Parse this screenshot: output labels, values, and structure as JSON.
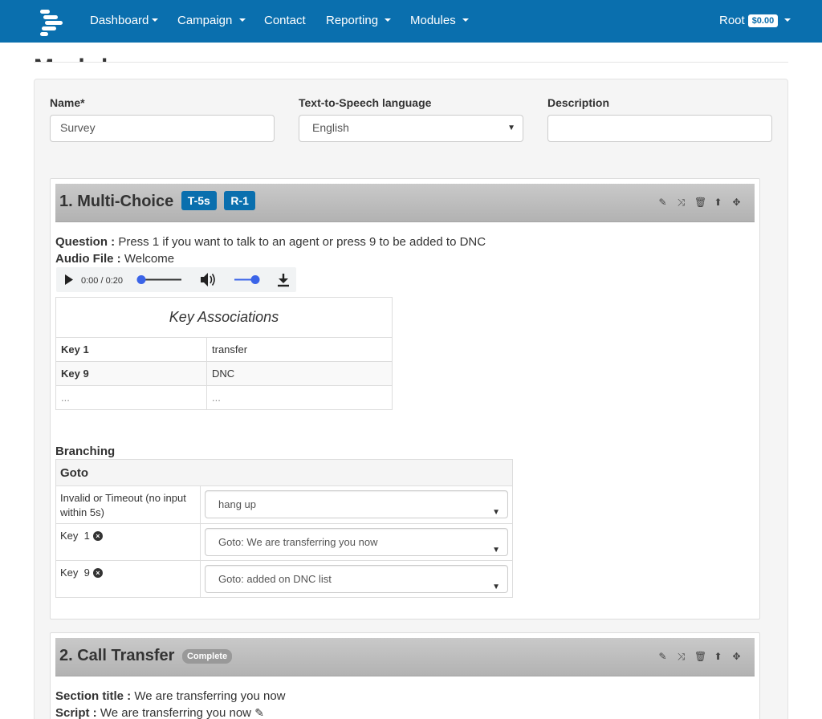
{
  "navbar": {
    "items": [
      "Dashboard",
      "Campaign",
      "Contact",
      "Reporting",
      "Modules"
    ],
    "user": "Root",
    "balance": "$0.00"
  },
  "page_title": "Modul",
  "form": {
    "name_label": "Name*",
    "name_value": "Survey",
    "tts_label": "Text-to-Speech language",
    "tts_value": "English",
    "desc_label": "Description",
    "desc_value": ""
  },
  "section1": {
    "title": "1. Multi-Choice",
    "tag_timeout": "T-5s",
    "tag_retry": "R-1",
    "question_label": "Question :",
    "question_value": "Press 1 if you want to talk to an agent or press 9 to be added to DNC",
    "audio_label": "Audio File :",
    "audio_value": "Welcome",
    "audio_time": "0:00 / 0:20",
    "audio_progress": 0,
    "audio_volume": 1,
    "key_table": {
      "title": "Key Associations",
      "rows": [
        {
          "key": "Key 1",
          "value": "transfer"
        },
        {
          "key": "Key 9",
          "value": "DNC"
        },
        {
          "key": "...",
          "value": "..."
        }
      ]
    },
    "branching": {
      "title": "Branching",
      "header": "Goto",
      "rows": [
        {
          "label": "Invalid or Timeout (no input within 5s)",
          "removable": false,
          "value": "hang up"
        },
        {
          "label": "Key  1",
          "removable": true,
          "value": "Goto: We are transferring you now"
        },
        {
          "label": "Key  9",
          "removable": true,
          "value": "Goto: added on DNC list"
        }
      ]
    }
  },
  "section2": {
    "title": "2. Call Transfer",
    "tag_status": "Complete",
    "section_title_label": "Section title :",
    "section_title_value": "We are transferring you now",
    "script_label": "Script :",
    "script_value": "We are transferring you now"
  },
  "icons": {
    "tools": [
      "pencil-icon",
      "shuffle-icon",
      "trash-icon",
      "arrow-up-circle-icon",
      "move-icon"
    ]
  },
  "colors": {
    "navbar": "#0a6fae",
    "tag": "#0a6fae",
    "complete_tag": "#999999",
    "audio_accent": "#3b64e8"
  }
}
